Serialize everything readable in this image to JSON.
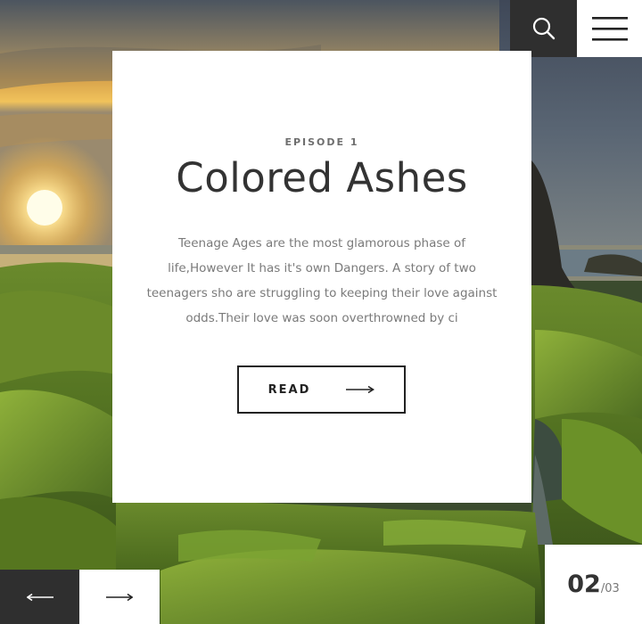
{
  "header": {
    "search_icon": "search-icon",
    "menu_icon": "hamburger-menu-icon"
  },
  "card": {
    "episode": "EPISODE 1",
    "title": "Colored Ashes",
    "description_lines": [
      "Teenage Ages are the most glamorous phase of",
      "life,However It has it's own Dangers. A story of two",
      "teenagers sho are struggling to keeping their love against",
      "odds.Their love was soon overthrowned by ci"
    ],
    "read_label": "READ",
    "read_icon": "arrow-right-icon"
  },
  "navigation": {
    "prev_icon": "arrow-left-icon",
    "next_icon": "arrow-right-icon"
  },
  "counter": {
    "current": "02",
    "total": "/03"
  },
  "colors": {
    "dark_panel": "#2f2f2f",
    "card_bg": "#ffffff",
    "title_text": "#333333",
    "body_text": "#7a7a7a"
  }
}
